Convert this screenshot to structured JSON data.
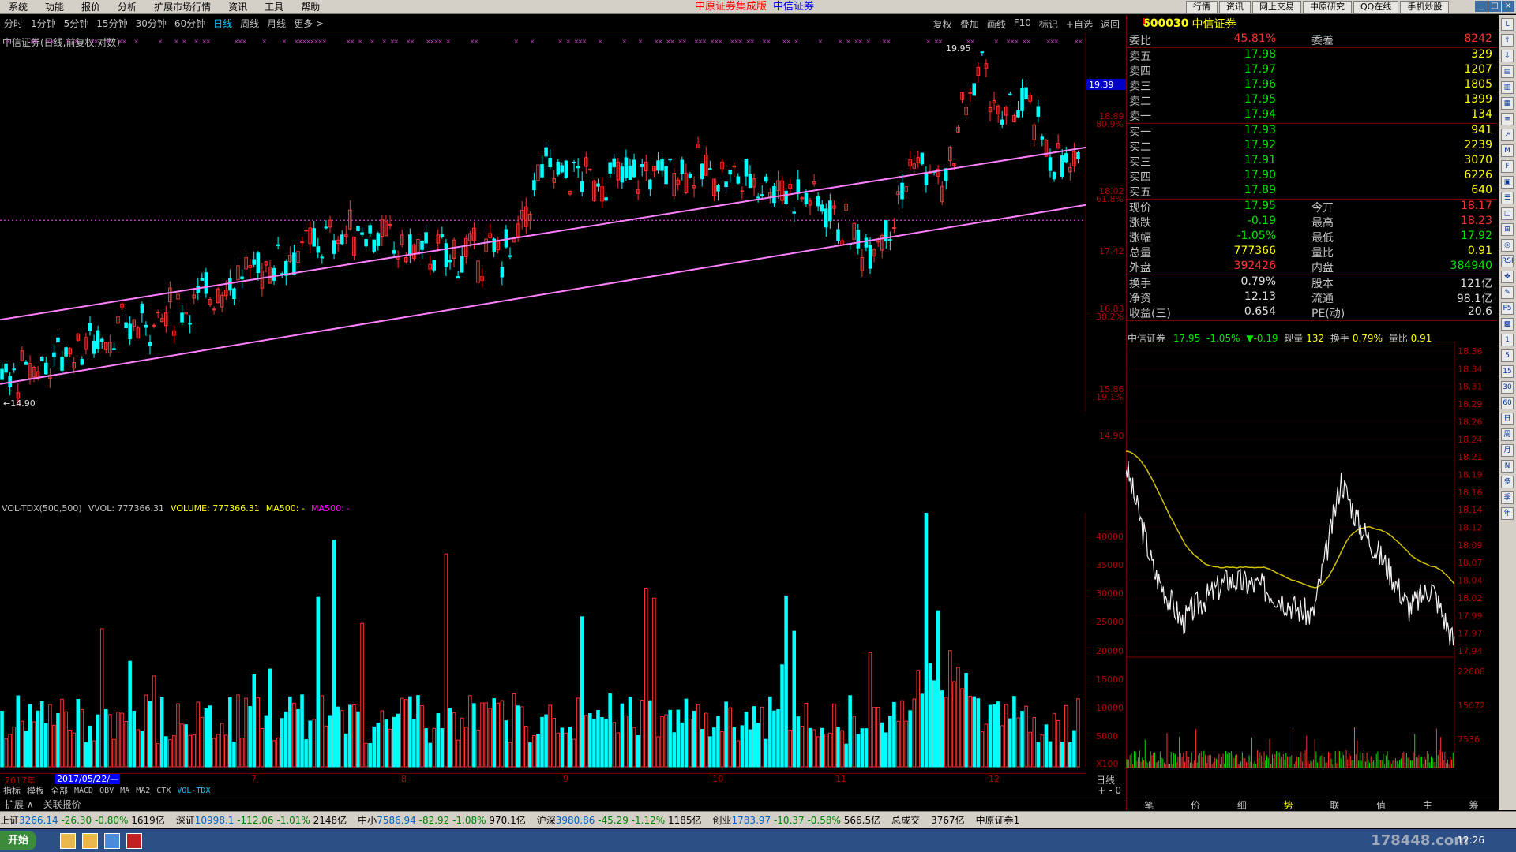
{
  "menu": [
    "系统",
    "功能",
    "报价",
    "分析",
    "扩展市场行情",
    "资讯",
    "工具",
    "帮助"
  ],
  "app_title": "中原证券集成版",
  "app_subtitle": "中信证券",
  "top_right_buttons": [
    "行情",
    "资讯",
    "网上交易",
    "中原研究",
    "QQ在线",
    "手机炒股"
  ],
  "periods": [
    "分时",
    "1分钟",
    "5分钟",
    "15分钟",
    "30分钟",
    "60分钟",
    "日线",
    "周线",
    "月线",
    "更多 >"
  ],
  "active_period": "日线",
  "chart_tools": [
    "复权",
    "叠加",
    "画线",
    "F10",
    "标记",
    "+自选",
    "返回"
  ],
  "chart_title": "中信证券(日线,前复权,对数)",
  "kline_annotations": {
    "high": "19.95",
    "low": "←14.90",
    "last_price_tag": "19.39"
  },
  "price_axis": [
    {
      "v": "18.89",
      "p": "80.9%"
    },
    {
      "v": "18.02",
      "p": "61.8%"
    },
    {
      "v": "17.42",
      "p": ""
    },
    {
      "v": "16.83",
      "p": "38.2%"
    },
    {
      "v": "15.86",
      "p": "19.1%"
    },
    {
      "v": "14.90",
      "p": ""
    }
  ],
  "volume_header": {
    "name": "VOL-TDX(500,500)",
    "vvol": "VVOL: 777366.31",
    "volume": "VOLUME: 777366.31",
    "ma1": "MA500: -",
    "ma2": "MA500: -"
  },
  "volume_axis": [
    "40000",
    "35000",
    "30000",
    "25000",
    "20000",
    "15000",
    "10000",
    "5000",
    "X100"
  ],
  "date_labels": [
    "2017年",
    "7",
    "8",
    "9",
    "10",
    "11",
    "12"
  ],
  "date_cursor": "2017/05/22/—",
  "right_mini_label": "日线",
  "right_mini_controls": "+ - 0",
  "indicator_tabs": [
    "指标",
    "模板",
    "全部",
    "MACD",
    "OBV",
    "MA",
    "MA2",
    "CTX",
    "VOL-TDX"
  ],
  "active_indicator": "VOL-TDX",
  "ext_tabs": [
    "扩展 ∧",
    "关联报价"
  ],
  "stock": {
    "code": "600030",
    "name": "中信证券",
    "marker": "L"
  },
  "order_book": {
    "weibi_label": "委比",
    "weibi": "45.81%",
    "weicha_label": "委差",
    "weicha": "8242",
    "asks": [
      {
        "label": "卖五",
        "price": "17.98",
        "vol": "329"
      },
      {
        "label": "卖四",
        "price": "17.97",
        "vol": "1207"
      },
      {
        "label": "卖三",
        "price": "17.96",
        "vol": "1805"
      },
      {
        "label": "卖二",
        "price": "17.95",
        "vol": "1399"
      },
      {
        "label": "卖一",
        "price": "17.94",
        "vol": "134"
      }
    ],
    "bids": [
      {
        "label": "买一",
        "price": "17.93",
        "vol": "941"
      },
      {
        "label": "买二",
        "price": "17.92",
        "vol": "2239"
      },
      {
        "label": "买三",
        "price": "17.91",
        "vol": "3070"
      },
      {
        "label": "买四",
        "price": "17.90",
        "vol": "6226"
      },
      {
        "label": "买五",
        "price": "17.89",
        "vol": "640"
      }
    ]
  },
  "quote": [
    {
      "l1": "现价",
      "v1": "17.95",
      "c1": "green",
      "l2": "今开",
      "v2": "18.17",
      "c2": "red"
    },
    {
      "l1": "涨跌",
      "v1": "-0.19",
      "c1": "green",
      "l2": "最高",
      "v2": "18.23",
      "c2": "red"
    },
    {
      "l1": "涨幅",
      "v1": "-1.05%",
      "c1": "green",
      "l2": "最低",
      "v2": "17.92",
      "c2": "green"
    },
    {
      "l1": "总量",
      "v1": "777366",
      "c1": "yellow",
      "l2": "量比",
      "v2": "0.91",
      "c2": "yellow"
    },
    {
      "l1": "外盘",
      "v1": "392426",
      "c1": "red",
      "l2": "内盘",
      "v2": "384940",
      "c2": "green"
    }
  ],
  "fundamentals": [
    {
      "l1": "换手",
      "v1": "0.79%",
      "l2": "股本",
      "v2": "121亿"
    },
    {
      "l1": "净资",
      "v1": "12.13",
      "l2": "流通",
      "v2": "98.1亿"
    },
    {
      "l1": "收益(三)",
      "v1": "0.654",
      "l2": "PE(动)",
      "v2": "20.6"
    }
  ],
  "intraday": {
    "name": "中信证券",
    "price": "17.95",
    "pct": "-1.05%",
    "chg": "▼-0.19",
    "now_vol_label": "现量",
    "now_vol": "132",
    "turnover_label": "换手",
    "turnover": "0.79%",
    "ratio_label": "量比",
    "ratio": "0.91",
    "axis": [
      "18.36",
      "18.34",
      "18.31",
      "18.29",
      "18.26",
      "18.24",
      "18.21",
      "18.19",
      "18.16",
      "18.14",
      "18.12",
      "18.09",
      "18.07",
      "18.04",
      "18.02",
      "17.99",
      "17.97",
      "17.94"
    ],
    "vol_axis": [
      "22608",
      "15072",
      "7536"
    ]
  },
  "bottom_tabs": [
    "笔",
    "价",
    "细",
    "势",
    "联",
    "值",
    "主",
    "筹"
  ],
  "active_bottom_tab": "势",
  "toolstrip": [
    "L",
    "⇧",
    "⇩",
    "▤",
    "▥",
    "▦",
    "≡",
    "↗",
    "M",
    "F",
    "▣",
    "☰",
    "▢",
    "⊞",
    "◎",
    "RSI",
    "✥",
    "✎",
    "F5",
    "▩",
    "1",
    "5",
    "15",
    "30",
    "60",
    "日",
    "周",
    "月",
    "N",
    "多",
    "季",
    "年"
  ],
  "status_indices": [
    {
      "name": "上证",
      "val": "3266.14",
      "chg": "-26.30",
      "pct": "-0.80%",
      "amt": "1619亿"
    },
    {
      "name": "深证",
      "val": "10998.1",
      "chg": "-112.06",
      "pct": "-1.01%",
      "amt": "2148亿"
    },
    {
      "name": "中小",
      "val": "7586.94",
      "chg": "-82.92",
      "pct": "-1.08%",
      "amt": "970.1亿"
    },
    {
      "name": "沪深",
      "val": "3980.86",
      "chg": "-45.29",
      "pct": "-1.12%",
      "amt": "1185亿"
    },
    {
      "name": "创业",
      "val": "1783.97",
      "chg": "-10.37",
      "pct": "-0.58%",
      "amt": "566.5亿"
    }
  ],
  "status_extra": [
    "总成交",
    "3767亿",
    "中原证券1"
  ],
  "taskbar": {
    "start": "开始",
    "clock": "12:26",
    "watermark": "178448.com"
  },
  "colors": {
    "up": "#ff3232",
    "down": "#00ffff",
    "channel": "#ff80ff",
    "grid": "#7a0000"
  }
}
